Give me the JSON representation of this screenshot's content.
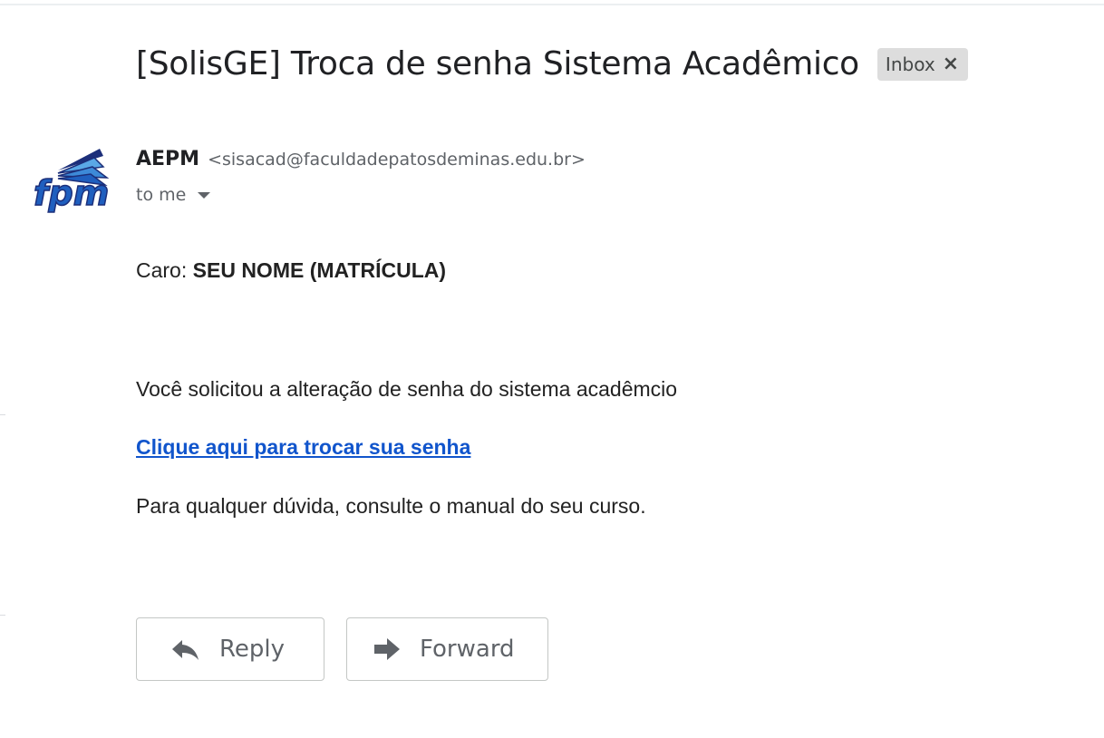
{
  "email": {
    "subject": "[SolisGE] Troca de senha Sistema Acadêmico",
    "label": "Inbox",
    "label_remove_glyph": "×",
    "sender": {
      "name": "AEPM",
      "email": "<sisacad@faculdadepatosdeminas.edu.br>",
      "avatar_text": "fpm",
      "avatar_colors": {
        "primary": "#1f5fbf",
        "secondary": "#5aa8e6",
        "outline": "#1c2f7a"
      }
    },
    "recipient": "to me",
    "body": {
      "greeting_prefix": "Caro:",
      "greeting_name": "SEU NOME (MATRÍCULA)",
      "line1": "Você solicitou a alteração de senha do sistema acadêmcio",
      "link_text": "Clique aqui para trocar sua senha",
      "line2": "Para qualquer dúvida, consulte o manual do seu curso."
    }
  },
  "actions": {
    "reply_label": "Reply",
    "forward_label": "Forward"
  },
  "colors": {
    "link": "#1155cc",
    "text": "#222222",
    "muted": "#5f6368",
    "chip_bg": "#dddddd"
  }
}
